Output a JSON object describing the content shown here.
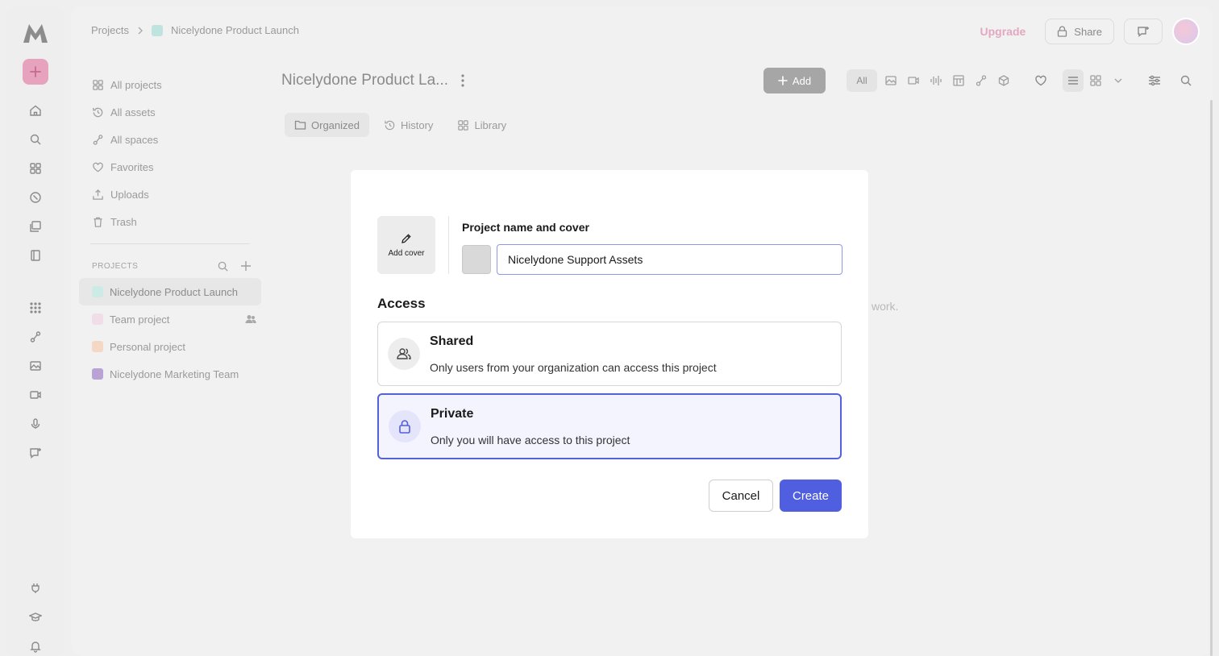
{
  "breadcrumb": {
    "root": "Projects",
    "current": "Nicelydone Product Launch"
  },
  "topbar": {
    "upgrade": "Upgrade",
    "share": "Share"
  },
  "sidebar": {
    "nav": [
      {
        "label": "All projects",
        "icon": "grid-icon"
      },
      {
        "label": "All assets",
        "icon": "history-icon"
      },
      {
        "label": "All spaces",
        "icon": "spaces-icon"
      },
      {
        "label": "Favorites",
        "icon": "heart-icon"
      },
      {
        "label": "Uploads",
        "icon": "upload-icon"
      },
      {
        "label": "Trash",
        "icon": "trash-icon"
      }
    ],
    "projects_header": "PROJECTS",
    "projects": [
      {
        "label": "Nicelydone Product Launch",
        "color": "#cdebe6"
      },
      {
        "label": "Team project",
        "color": "#f0dde8"
      },
      {
        "label": "Personal project",
        "color": "#f4d8c3"
      },
      {
        "label": "Nicelydone Marketing Team",
        "color": "#b9a3d4"
      }
    ]
  },
  "content": {
    "title": "Nicelydone Product La...",
    "add_label": "Add",
    "filter_all": "All",
    "tabs": [
      "Organized",
      "History",
      "Library"
    ],
    "hint": "work."
  },
  "modal": {
    "cover_label": "Add cover",
    "name_label": "Project name and cover",
    "name_value": "Nicelydone Support Assets",
    "access_label": "Access",
    "options": [
      {
        "title": "Shared",
        "description": "Only users from your organization can access this project"
      },
      {
        "title": "Private",
        "description": "Only you will have access to this project"
      }
    ],
    "cancel": "Cancel",
    "create": "Create"
  },
  "colors": {
    "accent": "#4f5fe0",
    "brand_pink": "#e7a3be"
  }
}
